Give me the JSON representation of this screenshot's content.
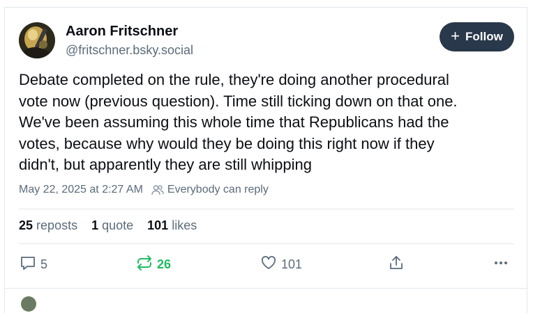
{
  "author": {
    "display_name": "Aaron Fritschner",
    "handle": "@fritschner.bsky.social"
  },
  "follow_button": {
    "label": "Follow"
  },
  "post": {
    "text": "Debate completed on the rule, they're doing another procedural\nvote now (previous question). Time still ticking down on that one.\nWe've been assuming this whole time that Republicans had the\nvotes, because why would they be doing this right now if they\ndidn't, but apparently they are still whipping",
    "timestamp": "May 22, 2025 at 2:27 AM",
    "reply_setting": "Everybody can reply"
  },
  "stats": {
    "reposts_count": "25",
    "reposts_label": "reposts",
    "quotes_count": "1",
    "quotes_label": "quote",
    "likes_count": "101",
    "likes_label": "likes"
  },
  "actions": {
    "reply_count": "5",
    "repost_count": "26",
    "like_count": "101"
  },
  "colors": {
    "follow_bg": "#29384a",
    "repost_active": "#20bc63",
    "muted_text": "#5b6b7b"
  }
}
